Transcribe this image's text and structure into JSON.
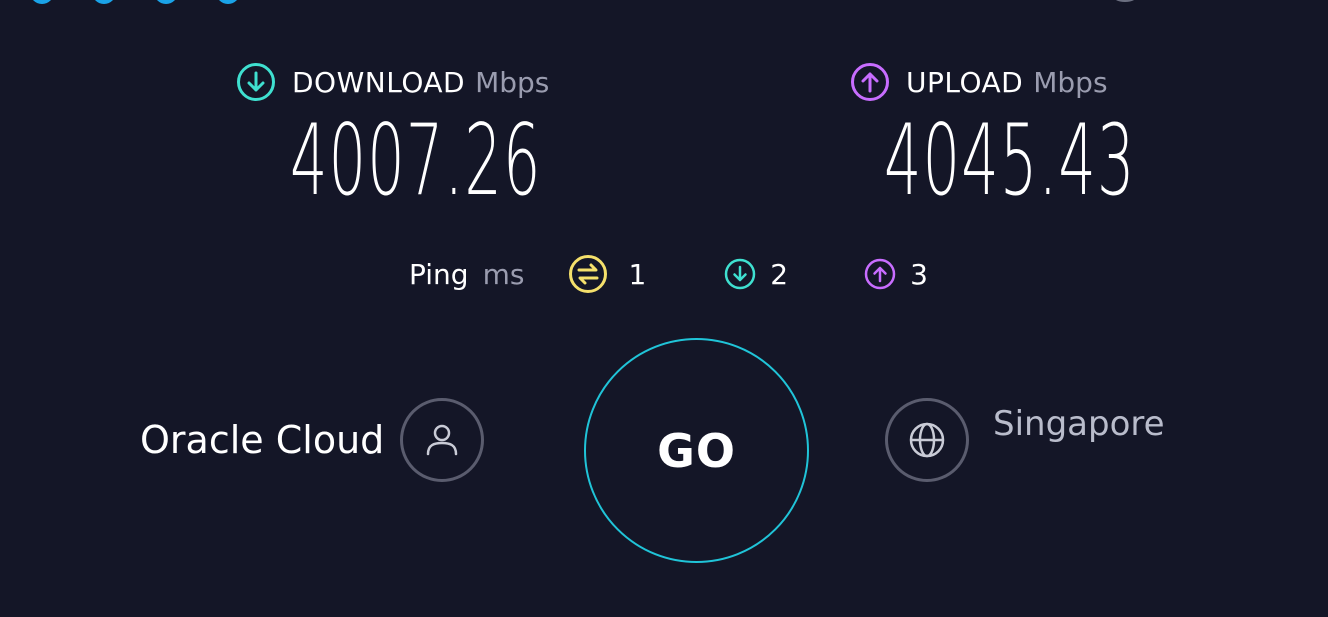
{
  "download": {
    "label": "DOWNLOAD",
    "unit": "Mbps",
    "value": "4007.26",
    "icon": "arrow-down-circle-icon",
    "color": "#3fe0d0"
  },
  "upload": {
    "label": "UPLOAD",
    "unit": "Mbps",
    "value": "4045.43",
    "icon": "arrow-up-circle-icon",
    "color": "#c86dff"
  },
  "ping": {
    "label": "Ping",
    "unit": "ms",
    "idle": {
      "value": "1",
      "icon": "ping-idle-icon",
      "color": "#f5e06b"
    },
    "download": {
      "value": "2",
      "icon": "ping-download-icon",
      "color": "#3fe0d0"
    },
    "upload": {
      "value": "3",
      "icon": "ping-upload-icon",
      "color": "#c86dff"
    }
  },
  "provider": {
    "name": "Oracle Cloud",
    "icon": "user-icon"
  },
  "go_button": {
    "label": "GO",
    "border_color": "#20c4d8"
  },
  "server": {
    "location": "Singapore",
    "icon": "globe-icon"
  }
}
